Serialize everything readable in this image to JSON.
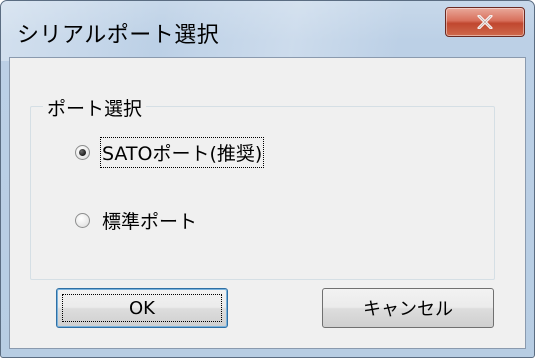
{
  "window": {
    "title": "シリアルポート選択",
    "close_icon": "close-x-icon"
  },
  "port_group": {
    "legend": "ポート選択",
    "options": [
      {
        "label": "SATOポート(推奨)",
        "selected": true
      },
      {
        "label": "標準ポート",
        "selected": false
      }
    ]
  },
  "buttons": {
    "ok_label": "OK",
    "cancel_label": "キャンセル"
  }
}
